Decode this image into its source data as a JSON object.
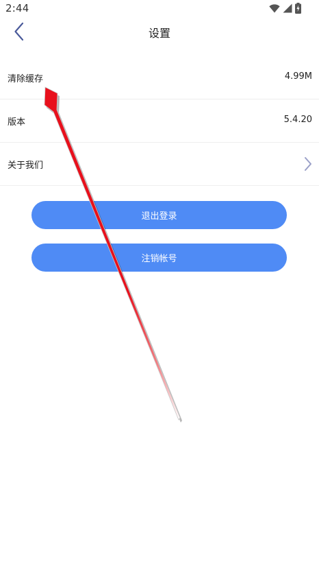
{
  "status_bar": {
    "time": "2:44",
    "icons": [
      "wifi-icon",
      "signal-icon",
      "battery-charging-icon"
    ]
  },
  "header": {
    "title": "设置",
    "back_icon": "chevron-left-icon"
  },
  "settings": {
    "items": [
      {
        "label": "清除缓存",
        "value": "4.99M"
      },
      {
        "label": "版本",
        "value": "5.4.20"
      },
      {
        "label": "关于我们",
        "value": "",
        "icon": "chevron-right-icon"
      }
    ]
  },
  "actions": {
    "logout_label": "退出登录",
    "deactivate_label": "注销帐号"
  },
  "colors": {
    "button_blue": "#4f8bf5",
    "annotation_red": "#e8101c",
    "back_icon": "#4a5a9a",
    "chevron": "#9aa0c8"
  },
  "annotation": {
    "icon": "red-arrow-annotation"
  }
}
